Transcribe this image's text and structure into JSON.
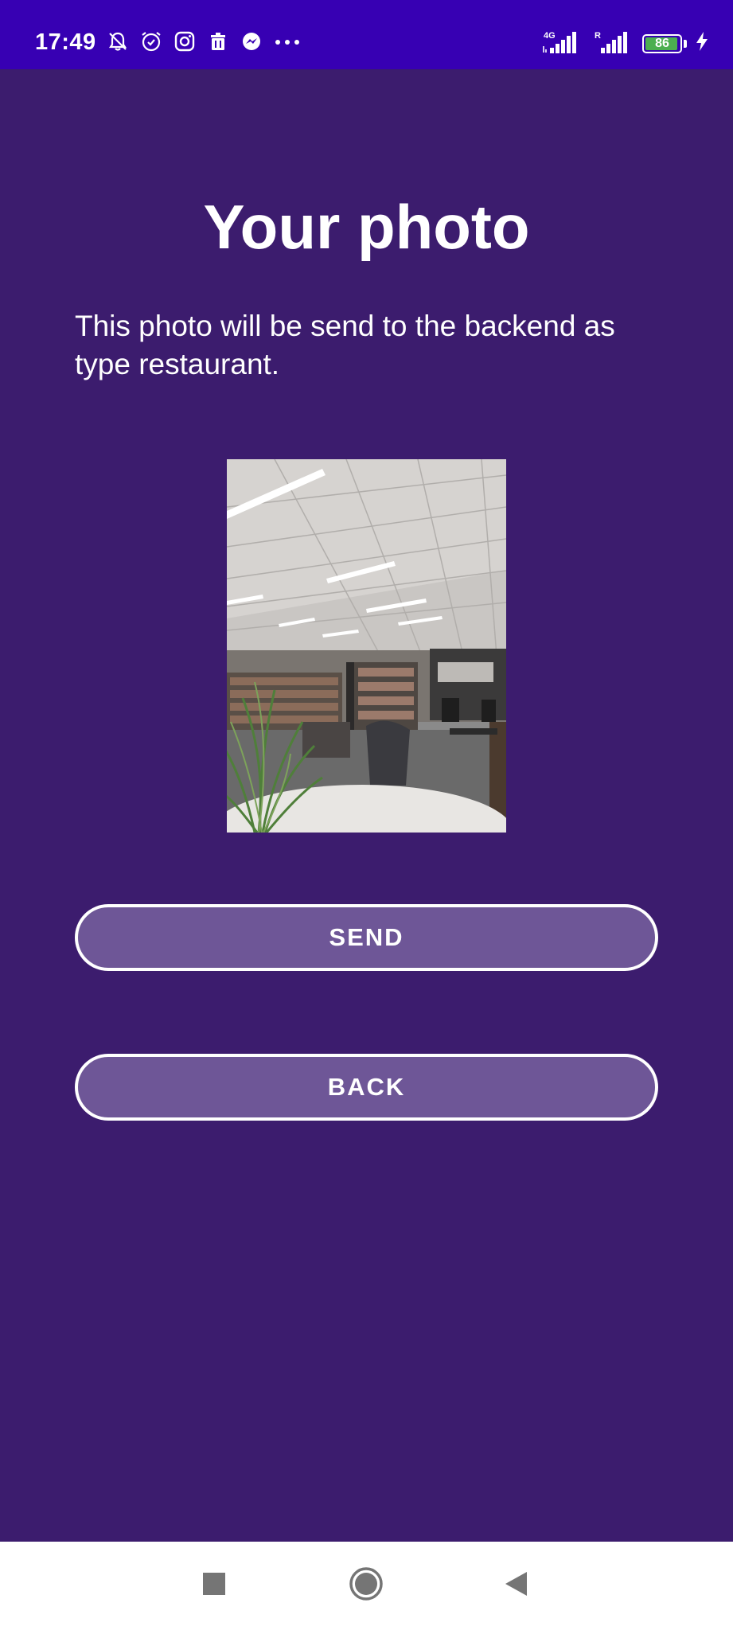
{
  "status_bar": {
    "time": "17:49",
    "left_icons": [
      "mute-bell-icon",
      "alarm-icon",
      "instagram-icon",
      "trash-icon",
      "messenger-icon",
      "more-dots-icon"
    ],
    "network_1_label": "4G",
    "network_2_label": "R",
    "battery_level": "86",
    "charging": true
  },
  "main": {
    "title": "Your photo",
    "description": "This photo will be send to the backend as type restaurant.",
    "send_label": "SEND",
    "back_label": "BACK"
  },
  "nav_bar": {
    "buttons": [
      "recents-icon",
      "home-icon",
      "back-triangle-icon"
    ]
  },
  "colors": {
    "background": "#3c1c6e",
    "status_bar": "#3700b3",
    "button_fill": "#6e5697",
    "button_border": "#ffffff",
    "battery_fill": "#4caf50"
  }
}
